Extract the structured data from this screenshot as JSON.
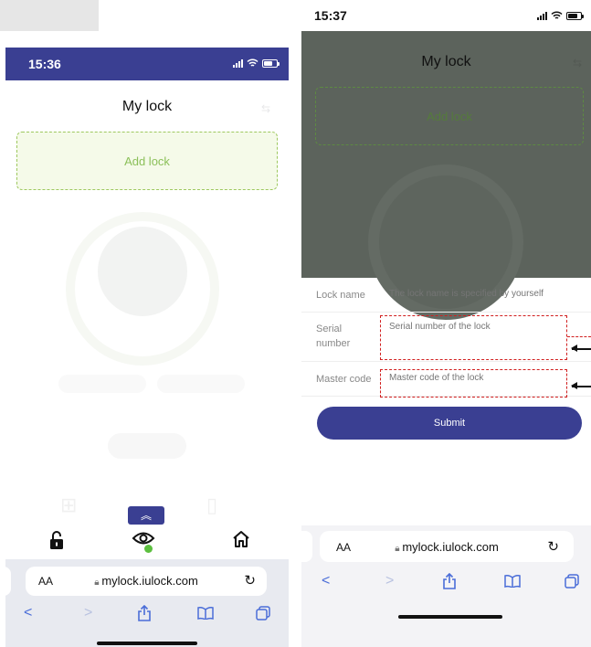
{
  "left_screen": {
    "status_time": "15:36",
    "page_title": "My lock",
    "add_lock_label": "Add lock",
    "address_aa": "AA",
    "address_url": "mylock.iulock.com",
    "accent": "#3a3f92",
    "icons": [
      "expand-up-icon",
      "unlock-icon",
      "eye-icon",
      "home-icon",
      "back-icon",
      "forward-icon",
      "share-icon",
      "bookmarks-icon",
      "tabs-icon",
      "reload-icon"
    ]
  },
  "right_screen": {
    "status_time": "15:37",
    "page_title": "My lock",
    "add_lock_label": "Add lock",
    "form": {
      "lock_name_label": "Lock name",
      "lock_name_placeholder": "The lock name is specified by yourself",
      "serial_label": "Serial number",
      "serial_placeholder": "Serial number of the lock",
      "master_label": "Master code",
      "master_placeholder": "Master code of the lock"
    },
    "submit_label": "Submit",
    "address_aa": "AA",
    "address_url": "mylock.iulock.com",
    "annotation_color": "#d11f1f"
  }
}
